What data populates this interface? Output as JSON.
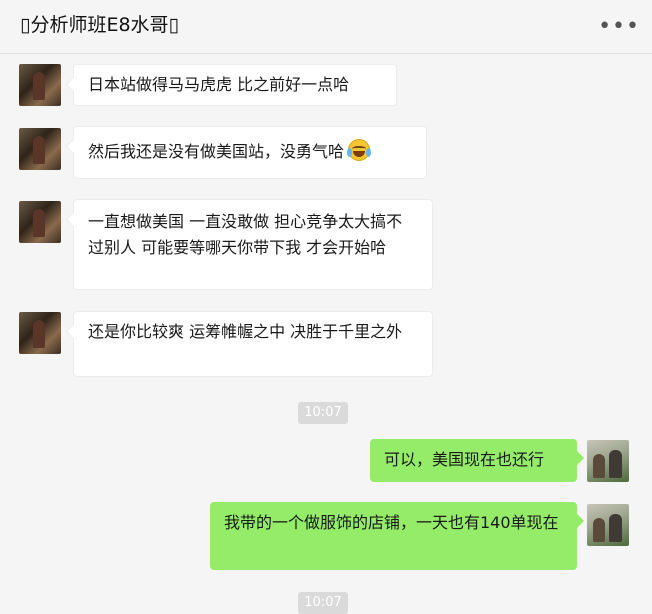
{
  "chat": {
    "title": "▯分析师班E8水哥▯",
    "more_label": "•••"
  },
  "messages": [
    {
      "side": "left",
      "text": "日本站做得马马虎虎 比之前好一点哈"
    },
    {
      "side": "left",
      "text": "然后我还是没有做美国站，没勇气哈",
      "emoji": "tears-of-joy-emoji"
    },
    {
      "side": "left",
      "text": "一直想做美国 一直没敢做 担心竞争太大搞不过别人 可能要等哪天你带下我 才会开始哈"
    },
    {
      "side": "left",
      "text": "还是你比较爽 运筹帷幄之中 决胜于千里之外"
    },
    {
      "side": "right",
      "text": "可以，美国现在也还行"
    },
    {
      "side": "right",
      "text": "我带的一个做服饰的店铺，一天也有140单现在"
    }
  ],
  "timestamps": [
    "10:07",
    "10:07"
  ]
}
